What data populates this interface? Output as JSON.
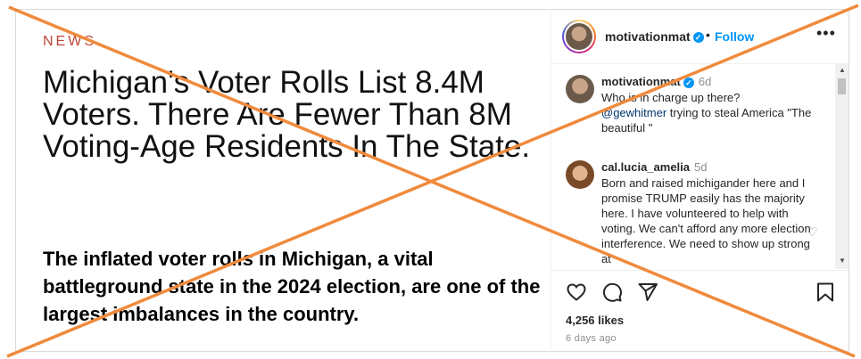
{
  "post_image": {
    "section_label": "NEWS",
    "headline": "Michigan's Voter Rolls List 8.4M Voters. There Are Fewer Than 8M Voting-Age Residents In The State.",
    "subheadline": "The inflated voter rolls in Michigan, a vital battleground state in the 2024 election, are one of the largest imbalances in the country."
  },
  "header": {
    "username": "motivationmat",
    "separator": "•",
    "follow_label": "Follow",
    "more_label": "•••"
  },
  "comments": [
    {
      "username": "motivationmat",
      "time": "6d",
      "text_before": "Who is in charge up there?",
      "mention": "@gewhitmer",
      "text_after": " trying to steal America \"The beautiful \""
    },
    {
      "username": "cal.lucia_amelia",
      "time": "5d",
      "text": "Born and raised michigander here and I promise TRUMP easily has the majority here. I have volunteered to help with voting. We can't afford any more election interference. We need to show up strong at"
    }
  ],
  "footer": {
    "likes": "4,256 likes",
    "time_ago": "6 days ago"
  },
  "icons": {
    "heart": "heart-icon",
    "comment": "comment-icon",
    "share": "share-icon",
    "bookmark": "bookmark-icon"
  },
  "colors": {
    "news_label": "#c0443a",
    "follow": "#0095f6",
    "mention": "#00376b",
    "cross_lines": "#f08a3c"
  }
}
